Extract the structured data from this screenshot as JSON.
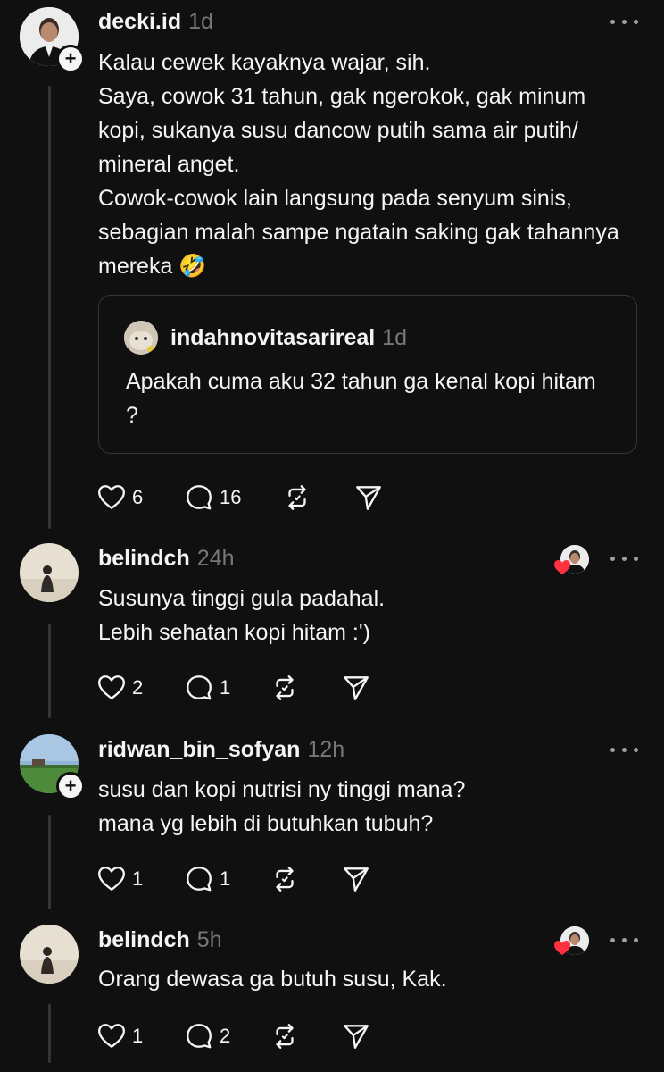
{
  "colors": {
    "background": "#101010",
    "text": "#f3f5f7",
    "muted": "#777777",
    "heart": "#ff3040"
  },
  "post": {
    "username": "decki.id",
    "time": "1d",
    "text": "Kalau cewek kayaknya wajar, sih.\nSaya, cowok 31 tahun, gak ngerokok, gak minum kopi, sukanya susu dancow putih sama air putih/ mineral anget.\nCowok-cowok lain langsung pada senyum sinis, sebagian malah sampe ngatain saking gak tahannya mereka 🤣",
    "quote": {
      "username": "indahnovitasarireal",
      "time": "1d",
      "text": "Apakah cuma aku 32 tahun ga kenal kopi hitam ?"
    },
    "likes": "6",
    "replies": "16"
  },
  "replies": [
    {
      "username": "belindch",
      "time": "24h",
      "text": "Susunya tinggi gula padahal.\nLebih sehatan kopi hitam :')",
      "likes": "2",
      "replies": "1"
    },
    {
      "username": "ridwan_bin_sofyan",
      "time": "12h",
      "text": "susu dan kopi nutrisi ny tinggi mana?\nmana yg lebih di butuhkan tubuh?",
      "likes": "1",
      "replies": "1"
    },
    {
      "username": "belindch",
      "time": "5h",
      "text": "Orang dewasa ga butuh susu, Kak.",
      "likes": "1",
      "replies": "2"
    }
  ],
  "icons": {
    "like": "heart-icon",
    "reply": "comment-icon",
    "repost": "repost-icon",
    "share": "send-icon",
    "more": "more-icon",
    "follow": "plus-icon"
  }
}
